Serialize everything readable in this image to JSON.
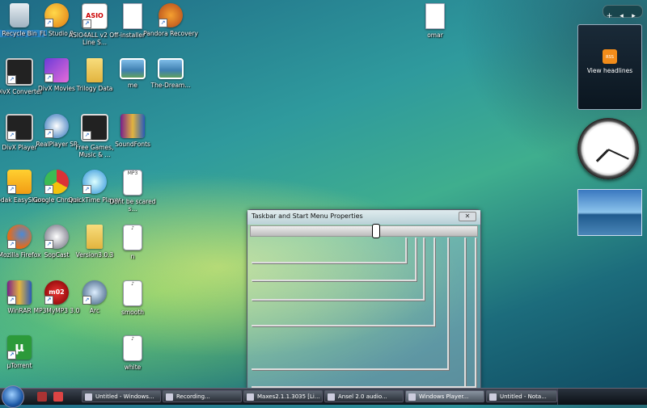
{
  "desktop": {
    "icons": [
      {
        "label": "Recycle Bin",
        "icon": "recycle-bin-icon"
      },
      {
        "label": "FL Studio 9",
        "icon": "fl-studio-icon"
      },
      {
        "label": "ASIO4ALL v2 Off-Line S...",
        "icon": "asio-icon"
      },
      {
        "label": "installer",
        "icon": "document-icon"
      },
      {
        "label": "Pandora Recovery",
        "icon": "pandora-icon"
      },
      {
        "label": "omar",
        "icon": "document-icon"
      },
      {
        "label": "DivX Converter",
        "icon": "divx-converter-icon"
      },
      {
        "label": "DivX Movies",
        "icon": "divx-movies-icon"
      },
      {
        "label": "Trilogy Data",
        "icon": "folder-icon"
      },
      {
        "label": "me",
        "icon": "image-icon"
      },
      {
        "label": "The-Dream...",
        "icon": "image-icon"
      },
      {
        "label": "DivX Player",
        "icon": "divx-player-icon"
      },
      {
        "label": "RealPlayer SP",
        "icon": "realplayer-icon"
      },
      {
        "label": "Free Games, Music & ...",
        "icon": "games-icon"
      },
      {
        "label": "SoundFonts",
        "icon": "winrar-icon"
      },
      {
        "label": "Kodak EasyShare",
        "icon": "kodak-icon"
      },
      {
        "label": "Google Chrome",
        "icon": "chrome-icon"
      },
      {
        "label": "QuickTime Player",
        "icon": "quicktime-icon"
      },
      {
        "label": "Dont be scared s...",
        "icon": "mp3-icon"
      },
      {
        "label": "Mozilla Firefox",
        "icon": "firefox-icon"
      },
      {
        "label": "SopCast",
        "icon": "sopcast-icon"
      },
      {
        "label": "Version3.0.3",
        "icon": "folder-icon"
      },
      {
        "label": "n",
        "icon": "audio-file-icon"
      },
      {
        "label": "WinRAR",
        "icon": "winrar-icon"
      },
      {
        "label": "MP3MyMP3 3.0",
        "icon": "mp3mymp3-icon"
      },
      {
        "label": "Arc",
        "icon": "arc-icon"
      },
      {
        "label": "smooth",
        "icon": "audio-file-icon"
      },
      {
        "label": "µTorrent",
        "icon": "utorrent-icon"
      },
      {
        "label": "white",
        "icon": "audio-file-icon"
      }
    ]
  },
  "sidebar": {
    "controls": [
      "+",
      "◂",
      "▸"
    ],
    "feed_gadget": {
      "label": "View headlines",
      "icon_text": "RSS"
    }
  },
  "dialog": {
    "title": "Taskbar and Start Menu Properties",
    "close_symbol": "✕"
  },
  "taskbar": {
    "buttons": [
      {
        "label": "Untitled - Windows..."
      },
      {
        "label": "Recording..."
      },
      {
        "label": "Untitled - Nota..."
      },
      {
        "label": "Maxes2.1.1.3035 [Li..."
      },
      {
        "label": "Ansel 2.0 audio..."
      },
      {
        "label": "Windows Player..."
      }
    ]
  }
}
